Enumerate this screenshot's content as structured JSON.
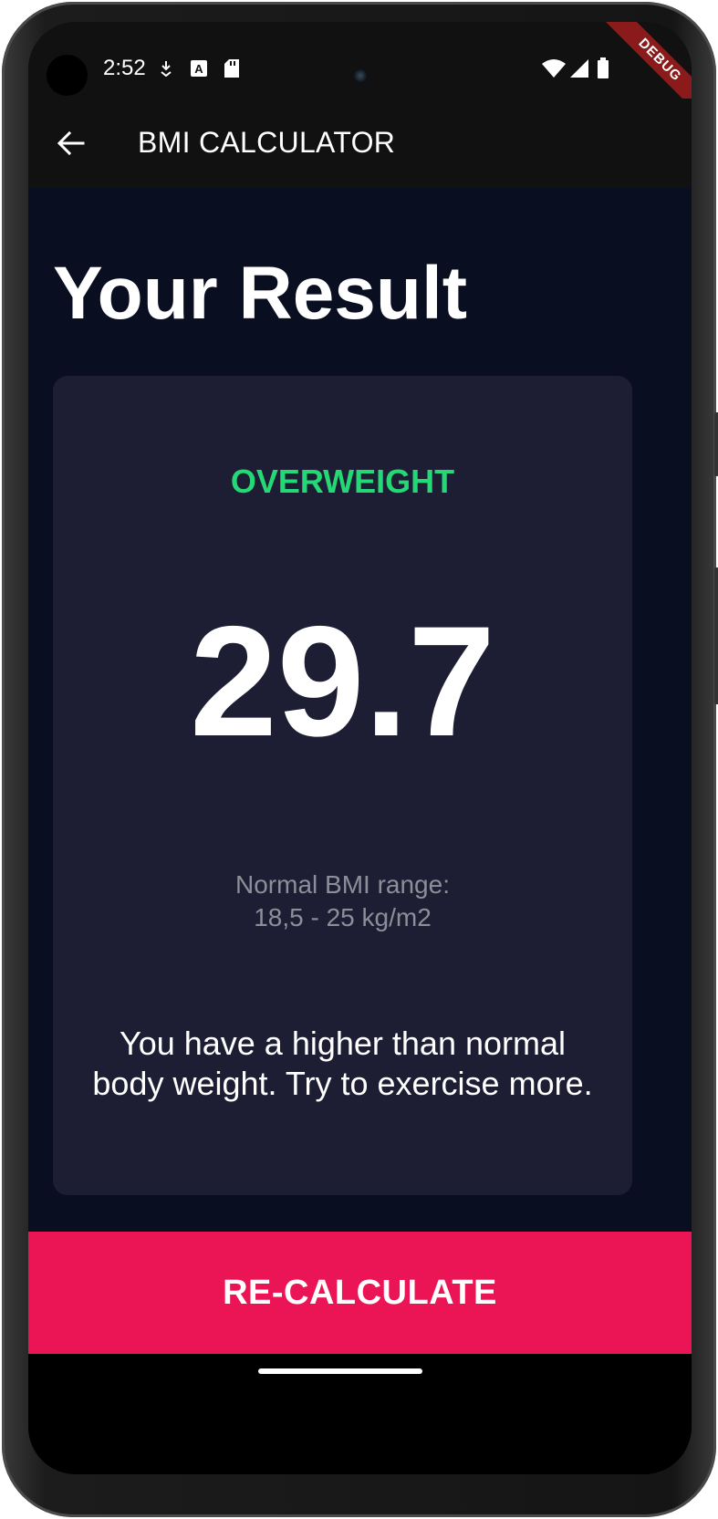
{
  "status_bar": {
    "time": "2:52",
    "icons": [
      "download-indicator-icon",
      "a-badge-icon",
      "sd-card-icon",
      "wifi-icon",
      "signal-icon",
      "battery-icon"
    ],
    "debug_banner": "DEBUG"
  },
  "app_bar": {
    "title": "BMI CALCULATOR",
    "back_icon": "arrow-left-icon"
  },
  "page": {
    "title": "Your Result"
  },
  "result": {
    "status": "OVERWEIGHT",
    "bmi": "29.7",
    "range_label": "Normal BMI range:",
    "range_value": "18,5 - 25 kg/m2",
    "advice": "You have a higher than normal body weight. Try to exercise more."
  },
  "action": {
    "label": "RE-CALCULATE"
  },
  "colors": {
    "background": "#0a0e21",
    "card": "#1d1e33",
    "status_green": "#24d876",
    "accent_pink": "#eb1555",
    "app_bar": "#111111"
  }
}
